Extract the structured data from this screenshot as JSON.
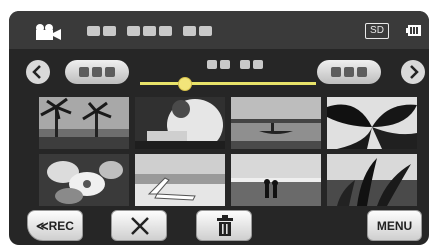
{
  "status_bar": {
    "mode_icon": "video-camera-icon",
    "title_placeholder_dots": 7,
    "media_label": "SD",
    "battery_icon": "battery-icon"
  },
  "navigator": {
    "prev_icon": "chevron-left-icon",
    "next_icon": "chevron-right-icon",
    "left_pill_icon": "dots-icon",
    "right_pill_icon": "dots-icon",
    "slider_position": 0.22,
    "accent_color": "#e8e36a"
  },
  "thumbnails": {
    "rows": 2,
    "columns": 4,
    "items": [
      {
        "name": "palm-trees-thumbnail"
      },
      {
        "name": "person-reading-thumbnail"
      },
      {
        "name": "boat-lake-thumbnail"
      },
      {
        "name": "palm-leaves-thumbnail"
      },
      {
        "name": "flower-closeup-thumbnail"
      },
      {
        "name": "beach-chair-thumbnail"
      },
      {
        "name": "couple-sunset-thumbnail"
      },
      {
        "name": "plant-silhouette-thumbnail"
      }
    ]
  },
  "toolbar": {
    "rec_label": "≪REC",
    "cancel_icon": "close-icon",
    "delete_icon": "trash-icon",
    "menu_label": "MENU"
  }
}
